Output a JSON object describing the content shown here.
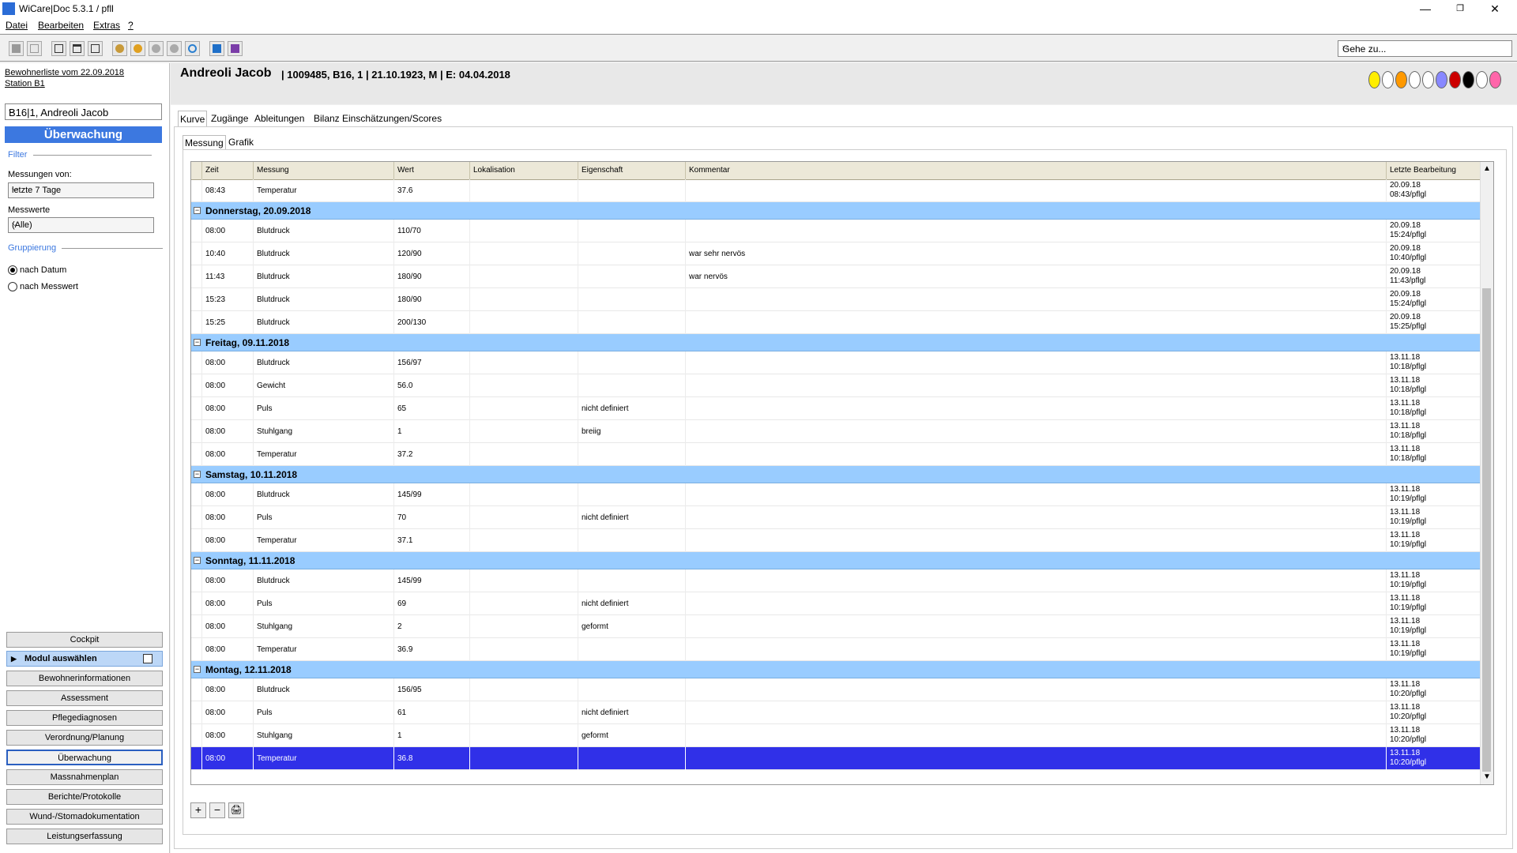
{
  "window": {
    "title": "WiCare|Doc 5.3.1  / pfll",
    "minimize_glyph": "—",
    "maximize_glyph": "❐",
    "close_glyph": "✕"
  },
  "menu": {
    "items": [
      "Datei",
      "Bearbeiten",
      "Extras",
      "?"
    ]
  },
  "toolbar": {
    "goto_value": "Gehe zu..."
  },
  "sidebar": {
    "resident_list_link": "Bewohnerliste vom 22.09.2018",
    "station_link": "Station B1",
    "resident_select": "B16|1, Andreoli Jacob",
    "module_title": "Überwachung",
    "filter_label": "Filter",
    "measurements_from_label": "Messungen von:",
    "measurements_from_value": "letzte 7 Tage",
    "measure_values_label": "Messwerte",
    "measure_values_value": "(Alle)",
    "grouping_label": "Gruppierung",
    "group_by_date": "nach Datum",
    "group_by_value": "nach Messwert",
    "nav": {
      "cockpit": "Cockpit",
      "module_select": "Modul auswählen",
      "resident_info": "Bewohnerinformationen",
      "assessment": "Assessment",
      "care_diagnoses": "Pflegediagnosen",
      "prescription": "Verordnung/Planung",
      "monitoring": "Überwachung",
      "measures_plan": "Massnahmenplan",
      "reports": "Berichte/Protokolle",
      "wound": "Wund-/Stomadokumentation",
      "services": "Leistungserfassung"
    }
  },
  "patient": {
    "name": "Andreoli Jacob",
    "info": "| 1009485, B16, 1 | 21.10.1923, M | E: 04.04.2018",
    "status_colors": [
      "#ffee00",
      "#ffffff",
      "#ff9900",
      "#ffffff",
      "#ffffff",
      "#8888ff",
      "#cc0000",
      "#000000",
      "#ffffff",
      "#ff66aa"
    ]
  },
  "tabs": [
    "Kurve",
    "Zugänge",
    "Ableitungen",
    "Bilanz",
    "Einschätzungen/Scores"
  ],
  "subtabs": [
    "Messung",
    "Grafik"
  ],
  "grid": {
    "columns": [
      "Zeit",
      "Messung",
      "Wert",
      "Lokalisation",
      "Eigenschaft",
      "Kommentar",
      "Letzte Bearbeitung"
    ],
    "rows": [
      {
        "t": "row",
        "zeit": "08:43",
        "mess": "Temperatur",
        "wert": "37.6",
        "lok": "",
        "eig": "",
        "kom": "",
        "l1": "20.09.18",
        "l2": "08:43/pflgl"
      },
      {
        "t": "group",
        "label": "Donnerstag, 20.09.2018"
      },
      {
        "t": "row",
        "zeit": "08:00",
        "mess": "Blutdruck",
        "wert": "110/70",
        "lok": "",
        "eig": "",
        "kom": "",
        "l1": "20.09.18",
        "l2": "15:24/pflgl"
      },
      {
        "t": "row",
        "zeit": "10:40",
        "mess": "Blutdruck",
        "wert": "120/90",
        "lok": "",
        "eig": "",
        "kom": "war sehr nervös",
        "l1": "20.09.18",
        "l2": "10:40/pflgl"
      },
      {
        "t": "row",
        "zeit": "11:43",
        "mess": "Blutdruck",
        "wert": "180/90",
        "lok": "",
        "eig": "",
        "kom": "war nervös",
        "l1": "20.09.18",
        "l2": "11:43/pflgl"
      },
      {
        "t": "row",
        "zeit": "15:23",
        "mess": "Blutdruck",
        "wert": "180/90",
        "lok": "",
        "eig": "",
        "kom": "",
        "l1": "20.09.18",
        "l2": "15:24/pflgl"
      },
      {
        "t": "row",
        "zeit": "15:25",
        "mess": "Blutdruck",
        "wert": "200/130",
        "lok": "",
        "eig": "",
        "kom": "",
        "l1": "20.09.18",
        "l2": "15:25/pflgl"
      },
      {
        "t": "group",
        "label": "Freitag, 09.11.2018"
      },
      {
        "t": "row",
        "zeit": "08:00",
        "mess": "Blutdruck",
        "wert": "156/97",
        "lok": "",
        "eig": "",
        "kom": "",
        "l1": "13.11.18",
        "l2": "10:18/pflgl"
      },
      {
        "t": "row",
        "zeit": "08:00",
        "mess": "Gewicht",
        "wert": "56.0",
        "lok": "",
        "eig": "",
        "kom": "",
        "l1": "13.11.18",
        "l2": "10:18/pflgl"
      },
      {
        "t": "row",
        "zeit": "08:00",
        "mess": "Puls",
        "wert": "65",
        "lok": "",
        "eig": "nicht definiert",
        "kom": "",
        "l1": "13.11.18",
        "l2": "10:18/pflgl"
      },
      {
        "t": "row",
        "zeit": "08:00",
        "mess": "Stuhlgang",
        "wert": "1",
        "lok": "",
        "eig": "breiig",
        "kom": "",
        "l1": "13.11.18",
        "l2": "10:18/pflgl"
      },
      {
        "t": "row",
        "zeit": "08:00",
        "mess": "Temperatur",
        "wert": "37.2",
        "lok": "",
        "eig": "",
        "kom": "",
        "l1": "13.11.18",
        "l2": "10:18/pflgl"
      },
      {
        "t": "group",
        "label": "Samstag, 10.11.2018"
      },
      {
        "t": "row",
        "zeit": "08:00",
        "mess": "Blutdruck",
        "wert": "145/99",
        "lok": "",
        "eig": "",
        "kom": "",
        "l1": "13.11.18",
        "l2": "10:19/pflgl"
      },
      {
        "t": "row",
        "zeit": "08:00",
        "mess": "Puls",
        "wert": "70",
        "lok": "",
        "eig": "nicht definiert",
        "kom": "",
        "l1": "13.11.18",
        "l2": "10:19/pflgl"
      },
      {
        "t": "row",
        "zeit": "08:00",
        "mess": "Temperatur",
        "wert": "37.1",
        "lok": "",
        "eig": "",
        "kom": "",
        "l1": "13.11.18",
        "l2": "10:19/pflgl"
      },
      {
        "t": "group",
        "label": "Sonntag, 11.11.2018"
      },
      {
        "t": "row",
        "zeit": "08:00",
        "mess": "Blutdruck",
        "wert": "145/99",
        "lok": "",
        "eig": "",
        "kom": "",
        "l1": "13.11.18",
        "l2": "10:19/pflgl"
      },
      {
        "t": "row",
        "zeit": "08:00",
        "mess": "Puls",
        "wert": "69",
        "lok": "",
        "eig": "nicht definiert",
        "kom": "",
        "l1": "13.11.18",
        "l2": "10:19/pflgl"
      },
      {
        "t": "row",
        "zeit": "08:00",
        "mess": "Stuhlgang",
        "wert": "2",
        "lok": "",
        "eig": "geformt",
        "kom": "",
        "l1": "13.11.18",
        "l2": "10:19/pflgl"
      },
      {
        "t": "row",
        "zeit": "08:00",
        "mess": "Temperatur",
        "wert": "36.9",
        "lok": "",
        "eig": "",
        "kom": "",
        "l1": "13.11.18",
        "l2": "10:19/pflgl"
      },
      {
        "t": "group",
        "label": "Montag, 12.11.2018"
      },
      {
        "t": "row",
        "zeit": "08:00",
        "mess": "Blutdruck",
        "wert": "156/95",
        "lok": "",
        "eig": "",
        "kom": "",
        "l1": "13.11.18",
        "l2": "10:20/pflgl"
      },
      {
        "t": "row",
        "zeit": "08:00",
        "mess": "Puls",
        "wert": "61",
        "lok": "",
        "eig": "nicht definiert",
        "kom": "",
        "l1": "13.11.18",
        "l2": "10:20/pflgl"
      },
      {
        "t": "row",
        "zeit": "08:00",
        "mess": "Stuhlgang",
        "wert": "1",
        "lok": "",
        "eig": "geformt",
        "kom": "",
        "l1": "13.11.18",
        "l2": "10:20/pflgl"
      },
      {
        "t": "row",
        "zeit": "08:00",
        "mess": "Temperatur",
        "wert": "36.8",
        "lok": "",
        "eig": "",
        "kom": "",
        "l1": "13.11.18",
        "l2": "10:20/pflgl",
        "selected": true
      }
    ]
  },
  "actions": {
    "add": "+",
    "remove": "−",
    "print": "🖨"
  }
}
